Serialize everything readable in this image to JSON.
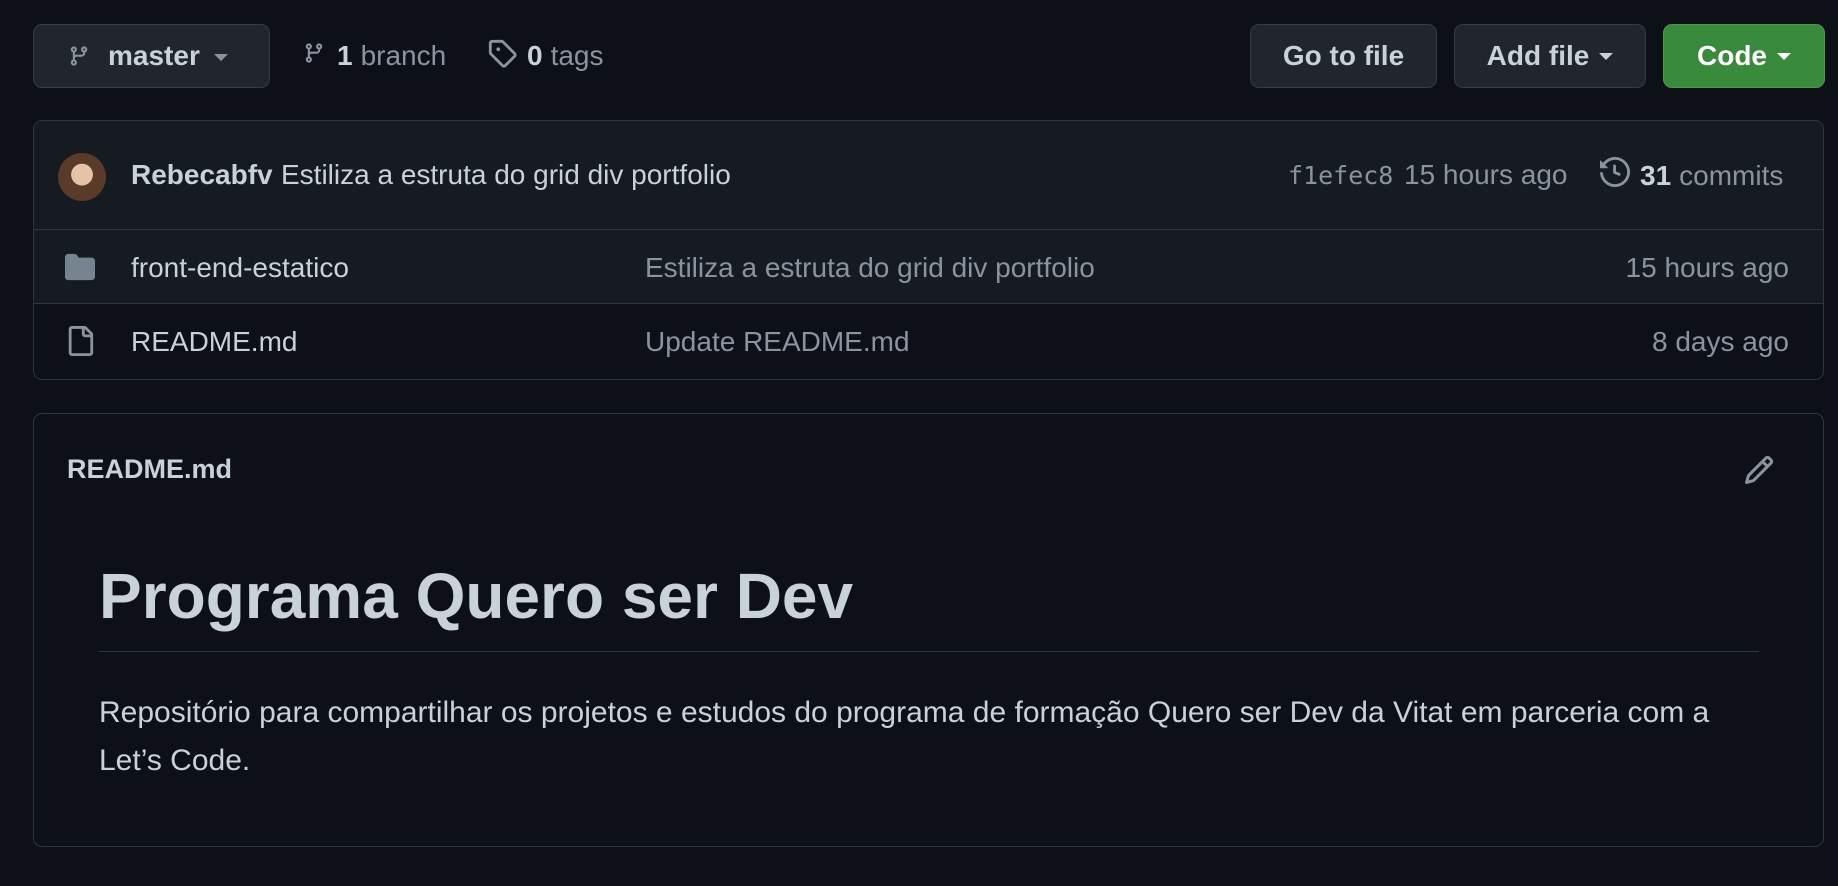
{
  "toolbar": {
    "branch_name": "master",
    "branch_count": "1",
    "branch_word": "branch",
    "tag_count": "0",
    "tag_word": "tags",
    "goto_file_label": "Go to file",
    "add_file_label": "Add file",
    "code_label": "Code"
  },
  "latest_commit": {
    "author": "Rebecabfv",
    "message": "Estiliza a estruta do grid div portfolio",
    "sha": "f1efec8",
    "time": "15 hours ago",
    "commit_count": "31",
    "commit_word": "commits"
  },
  "files": [
    {
      "type": "folder",
      "name": "front-end-estatico",
      "message": "Estiliza a estruta do grid div portfolio",
      "age": "15 hours ago"
    },
    {
      "type": "file",
      "name": "README.md",
      "message": "Update README.md",
      "age": "8 days ago"
    }
  ],
  "readme": {
    "filename": "README.md",
    "heading": "Programa Quero ser Dev",
    "paragraph": "Repositório para compartilhar os projetos e estudos do programa de formação Quero ser Dev da Vitat em parceria com a Let’s Code."
  },
  "colors": {
    "background": "#0d1117",
    "code_button": "#3a8a3d",
    "border": "#30363d",
    "muted_text": "#8b949e"
  },
  "icons": [
    "git-branch-icon",
    "tag-icon",
    "history-icon",
    "folder-icon",
    "file-icon",
    "pencil-icon",
    "caret-down-icon"
  ]
}
